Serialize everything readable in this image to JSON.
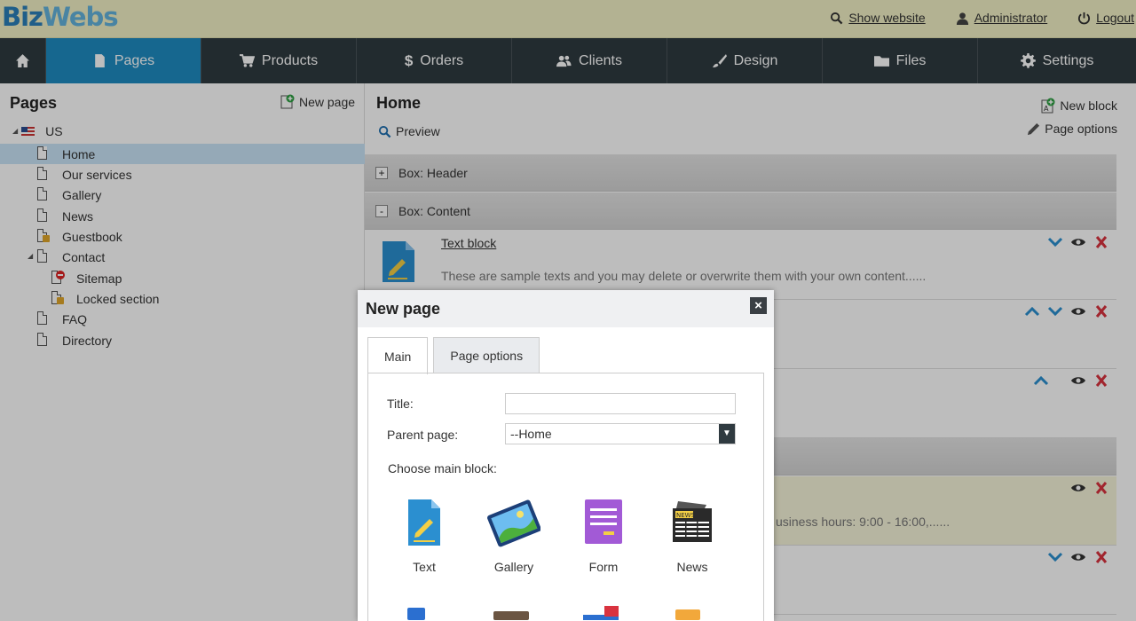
{
  "brand": {
    "part1": "Biz",
    "part2": "Webs"
  },
  "toplinks": {
    "show_website": "Show website",
    "administrator": "Administrator",
    "logout": "Logout"
  },
  "nav": [
    "Pages",
    "Products",
    "Orders",
    "Clients",
    "Design",
    "Files",
    "Settings"
  ],
  "sidebar": {
    "title": "Pages",
    "new_page": "New page",
    "root": "US",
    "items": [
      "Home",
      "Our services",
      "Gallery",
      "News",
      "Guestbook",
      "Contact",
      "Sitemap",
      "Locked section",
      "FAQ",
      "Directory"
    ]
  },
  "main": {
    "title": "Home",
    "preview": "Preview",
    "new_block": "New block",
    "page_options": "Page options",
    "box_header": "Box: Header",
    "box_content": "Box: Content",
    "text_block_title": "Text block",
    "text_block_text": "These are sample texts and you may delete or overwrite them with your own content......",
    "hours_text": "usiness hours: 9:00 - 16:00,......"
  },
  "modal": {
    "title": "New page",
    "tab_main": "Main",
    "tab_options": "Page options",
    "title_label": "Title:",
    "title_value": "",
    "parent_label": "Parent page:",
    "parent_value": "--Home",
    "choose_label": "Choose main block:",
    "blocks": [
      "Text",
      "Gallery",
      "Form",
      "News"
    ]
  },
  "colors": {
    "accent": "#1e8cc2",
    "nav": "#2f3a40",
    "topbar": "#f2f1c5",
    "delete": "#d9333f",
    "arrow": "#2b8fd0"
  }
}
